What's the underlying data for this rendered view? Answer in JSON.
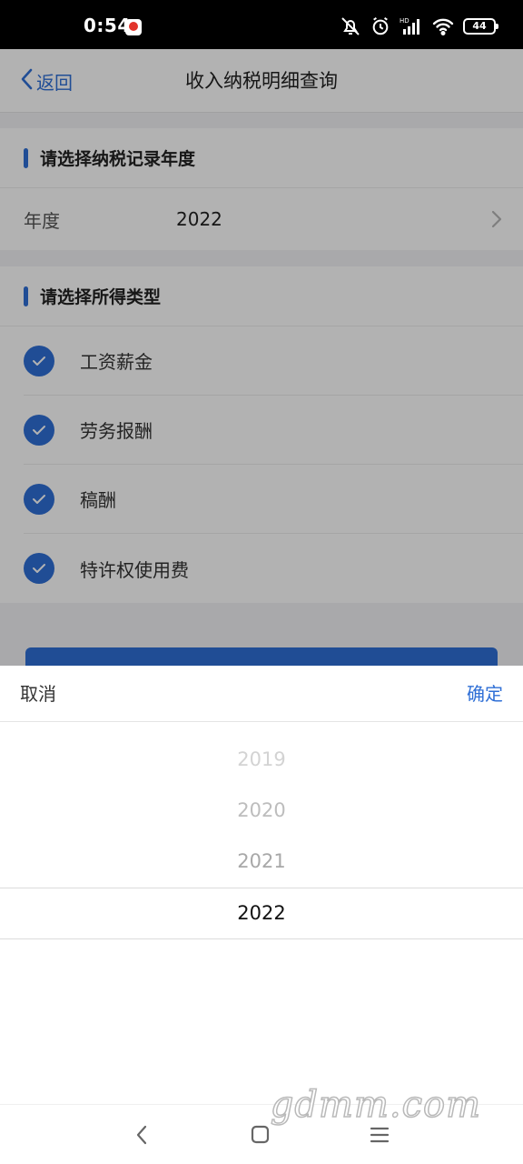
{
  "status_bar": {
    "time": "0:54",
    "battery": "44",
    "icons": [
      "mute-icon",
      "alarm-icon",
      "hd-signal-icon",
      "wifi-icon",
      "battery-icon"
    ]
  },
  "nav": {
    "back_label": "返回",
    "title": "收入纳税明细查询"
  },
  "year_section": {
    "heading": "请选择纳税记录年度",
    "field_label": "年度",
    "field_value": "2022"
  },
  "income_section": {
    "heading": "请选择所得类型",
    "items": [
      {
        "label": "工资薪金",
        "checked": true
      },
      {
        "label": "劳务报酬",
        "checked": true
      },
      {
        "label": "稿酬",
        "checked": true
      },
      {
        "label": "特许权使用费",
        "checked": true
      }
    ]
  },
  "picker": {
    "cancel_label": "取消",
    "confirm_label": "确定",
    "options": [
      "2019",
      "2020",
      "2021",
      "2022"
    ],
    "selected": "2022"
  },
  "watermark": "gdmm.com",
  "colors": {
    "accent": "#2f6fd6",
    "overlay": "rgba(0,0,0,0.30)"
  }
}
